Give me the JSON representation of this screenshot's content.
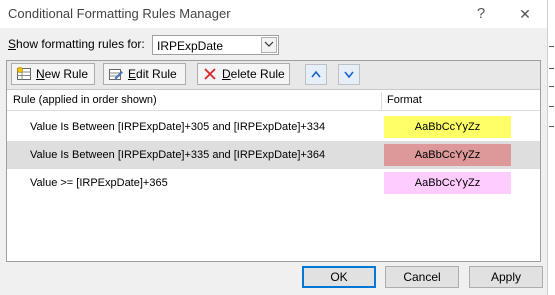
{
  "window": {
    "title": "Conditional Formatting Rules Manager",
    "help_glyph": "?",
    "close_glyph": "✕"
  },
  "show_rules": {
    "label_prefix": "S",
    "label_rest": "how formatting rules for:",
    "selected": "IRPExpDate"
  },
  "toolbar": {
    "new_rule_mnemonic": "N",
    "new_rule_rest": "ew Rule",
    "edit_rule_mnemonic": "E",
    "edit_rule_rest": "dit Rule",
    "delete_rule_mnemonic": "D",
    "delete_rule_rest": "elete Rule"
  },
  "table": {
    "col_rule": "Rule (applied in order shown)",
    "col_format": "Format",
    "rows": [
      {
        "rule": "Value Is Between [IRPExpDate]+305 and [IRPExpDate]+334",
        "preview": "AaBbCcYyZz",
        "color": "#ffff66",
        "selected": false
      },
      {
        "rule": "Value Is Between [IRPExpDate]+335 and [IRPExpDate]+364",
        "preview": "AaBbCcYyZz",
        "color": "#dd9999",
        "selected": true
      },
      {
        "rule": "Value >= [IRPExpDate]+365",
        "preview": "AaBbCcYyZz",
        "color": "#ffccff",
        "selected": false
      }
    ]
  },
  "buttons": {
    "ok": "OK",
    "cancel": "Cancel",
    "apply": "Apply"
  },
  "colors": {
    "accent": "#0078d7",
    "selected_row": "#dedede"
  }
}
